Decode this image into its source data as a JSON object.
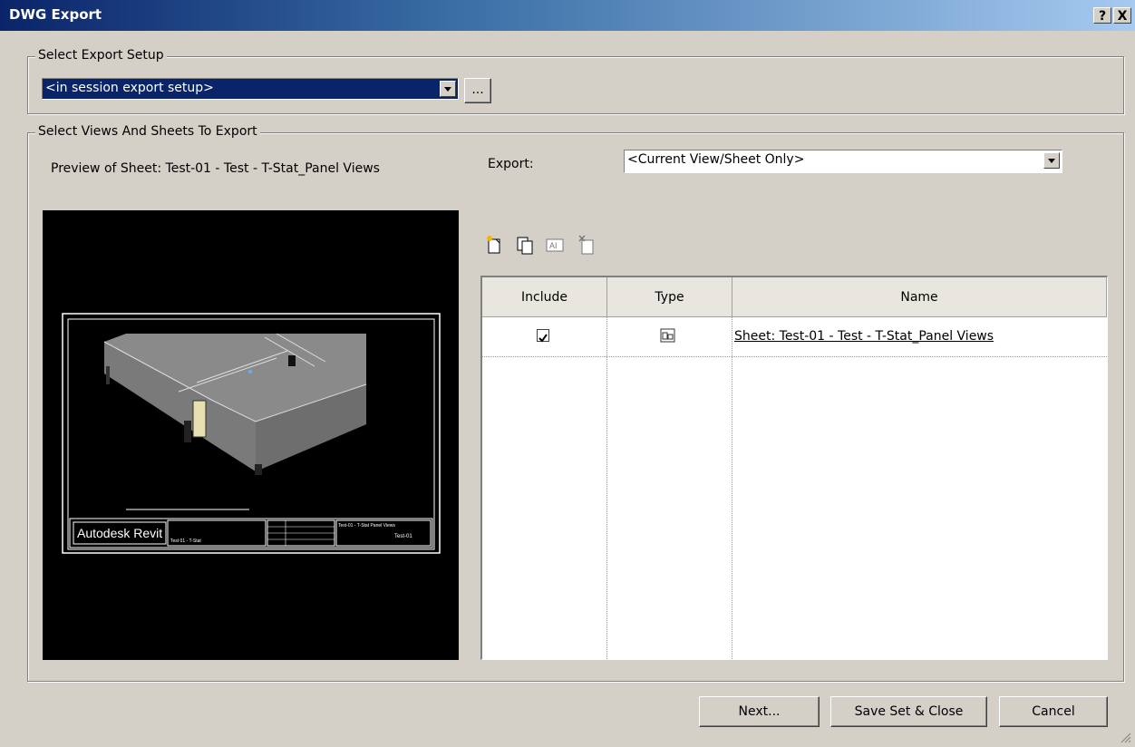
{
  "window": {
    "title": "DWG Export",
    "help_btn": "?",
    "close_btn": "X"
  },
  "export_setup": {
    "legend": "Select Export Setup",
    "selected": "<in session export setup>",
    "more_btn": "..."
  },
  "views": {
    "legend": "Select Views And Sheets To Export",
    "preview_caption": "Preview of Sheet: Test-01 - Test - T-Stat_Panel Views",
    "export_label": "Export:",
    "export_selected": "<Current View/Sheet Only>"
  },
  "preview": {
    "logo_text": "Autodesk Revit",
    "project_text": "Test 01 - T-Stat",
    "sheet_name": "Test-01 - T-Stat Panel Views",
    "sheet_number": "Test-01"
  },
  "toolbar": {
    "icons": [
      "new-set-icon",
      "duplicate-set-icon",
      "rename-set-icon",
      "delete-set-icon"
    ]
  },
  "table": {
    "columns": [
      "Include",
      "Type",
      "Name"
    ],
    "rows": [
      {
        "include": true,
        "type_icon": "sheet-icon",
        "name": "Sheet: Test-01 - Test - T-Stat_Panel Views"
      }
    ]
  },
  "buttons": {
    "next": "Next...",
    "save": "Save Set & Close",
    "cancel": "Cancel"
  }
}
